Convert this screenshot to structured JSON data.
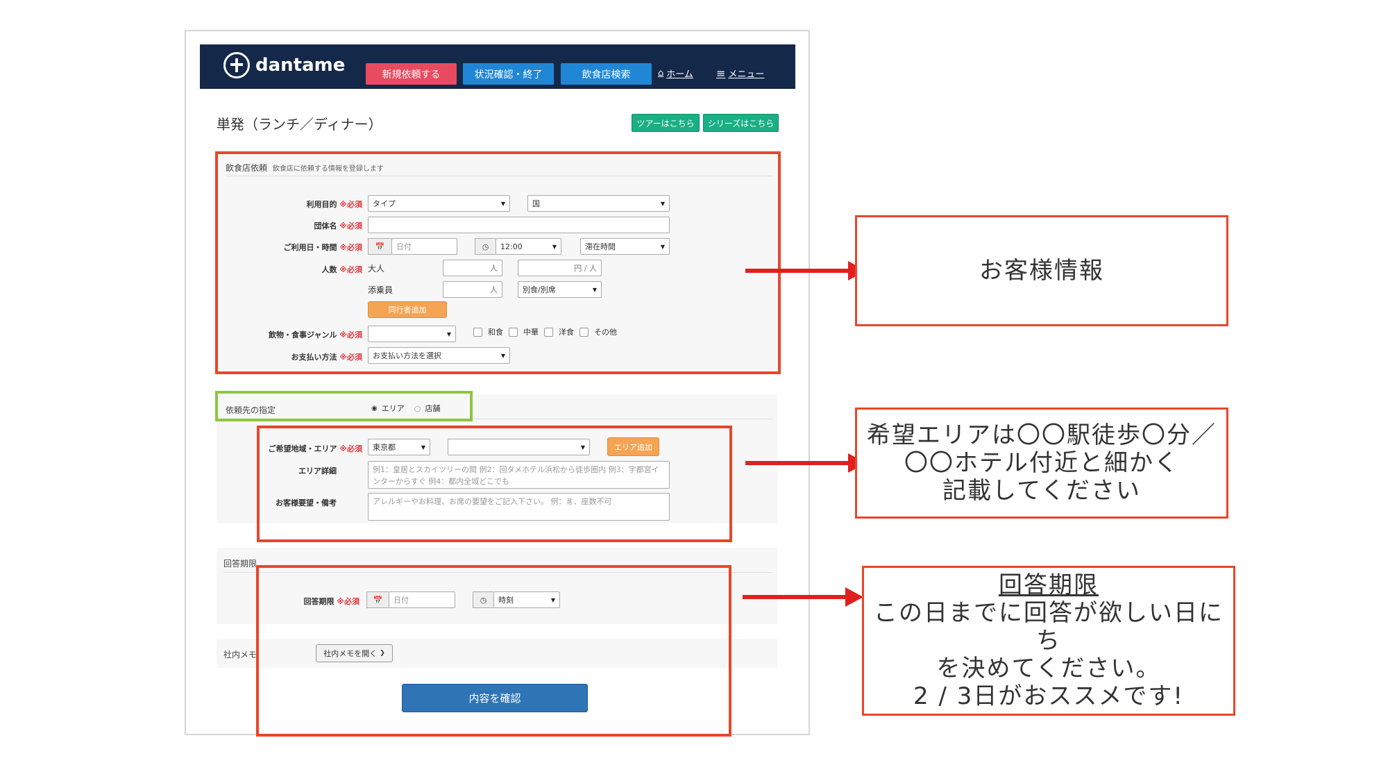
{
  "brand": {
    "name": "dantame"
  },
  "nav": {
    "buttons": [
      {
        "label": "新規依頼する",
        "color": "#e84a5f"
      },
      {
        "label": "状況確認・終了",
        "color": "#1f87d6"
      },
      {
        "label": "飲食店検索",
        "color": "#1f87d6"
      }
    ],
    "links": [
      {
        "label": "ホーム",
        "icon": "home-icon"
      },
      {
        "label": "メニュー",
        "icon": "menu-icon"
      }
    ]
  },
  "page": {
    "title": "単発（ランチ／ディナー）",
    "tour_button": "ツアーはこちら",
    "series_button": "シリーズはこちら"
  },
  "restaurant_request": {
    "heading": "飲食店依頼",
    "subheading": "飲食店に依頼する情報を登録します",
    "required_mark": "※必須",
    "purpose": {
      "label": "利用目的",
      "type_value": "タイプ",
      "second_value": "国"
    },
    "group_name": {
      "label": "団体名"
    },
    "datetime": {
      "label": "ご利用日・時間",
      "date_placeholder": "日付",
      "time_value": "12:00",
      "stay_value": "滞在時間"
    },
    "people": {
      "label": "人数",
      "adult_label": "大人",
      "adult_unit": "人",
      "price_unit": "円 / 人",
      "crew_label": "添乗員",
      "crew_unit": "人",
      "crew_meal_value": "別食/別席"
    },
    "add_companion_button": "同行者追加",
    "genre": {
      "label": "飲物・食事ジャンル",
      "options": [
        "和食",
        "中華",
        "洋食",
        "その他"
      ]
    },
    "payment": {
      "label": "お支払い方法",
      "value": "お支払い方法を選択"
    }
  },
  "destination": {
    "heading": "依頼先の指定",
    "radio_options": [
      "エリア",
      "店舗"
    ],
    "region": {
      "label": "ご希望地域・エリア",
      "pref_value": "東京都",
      "add_area_button": "エリア追加"
    },
    "area_detail": {
      "label": "エリア詳細",
      "placeholder": "例1：皇居とスカイツリーの間 例2：回タメホテル浜松から徒歩圏内 例3：宇都宮インターからすぐ 例4：都内全域どこでも"
    },
    "customer_request": {
      "label": "お客様要望・備考",
      "placeholder": "アレルギーやお料理、お席の要望をご記入下さい。 例：豸、座数不可"
    }
  },
  "deadline": {
    "heading": "回答期限",
    "label": "回答期限",
    "date_placeholder": "日付",
    "time_value": "時刻"
  },
  "internal_memo": {
    "heading": "社内メモ",
    "toggle_button": "社内メモを開く"
  },
  "confirm_button": "内容を確認",
  "annotations": {
    "customer_info": "お客様情報",
    "area_note": [
      "希望エリアは〇〇駅徒歩〇分／",
      "〇〇ホテル付近と細かく",
      "記載してください"
    ],
    "deadline_title": "回答期限",
    "deadline_note": [
      "この日までに回答が欲しい日にち",
      "を決めてください。",
      "2 / 3日がおススメです!"
    ]
  },
  "colors": {
    "navbar": "#14284a",
    "highlight_red": "#e8472a",
    "highlight_green": "#8dc63f",
    "arrow": "#e11f1f",
    "confirm": "#2f74b5"
  }
}
